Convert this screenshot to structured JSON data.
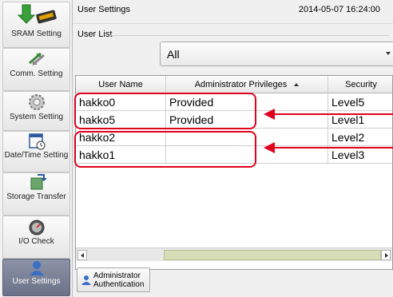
{
  "sidebar": {
    "items": [
      {
        "label": "SRAM Setting",
        "icon": "sram-icon",
        "active": false
      },
      {
        "label": "Comm. Setting",
        "icon": "comm-arrows-icon",
        "active": false
      },
      {
        "label": "System Setting",
        "icon": "gear-icon",
        "active": false
      },
      {
        "label": "Date/Time Setting",
        "icon": "calendar-clock-icon",
        "active": false
      },
      {
        "label": "Storage Transfer",
        "icon": "storage-transfer-icon",
        "active": false
      },
      {
        "label": "I/O Check",
        "icon": "gauge-icon",
        "active": false
      },
      {
        "label": "User Settings",
        "icon": "user-icon",
        "active": true
      }
    ]
  },
  "header": {
    "title": "User Settings",
    "timestamp": "2014-05-07 16:24:00"
  },
  "user_list": {
    "label": "User List",
    "filter": {
      "value": "All"
    },
    "columns": [
      "User Name",
      "Administrator Privileges",
      "Security"
    ],
    "rows": [
      {
        "name": "hakko0",
        "admin": "Provided",
        "security": "Level5"
      },
      {
        "name": "hakko5",
        "admin": "Provided",
        "security": "Level1"
      },
      {
        "name": "hakko2",
        "admin": "",
        "security": "Level2"
      },
      {
        "name": "hakko1",
        "admin": "",
        "security": "Level3"
      }
    ]
  },
  "admin_button": {
    "label": "Administrator Authentication",
    "icon": "user-key-icon"
  },
  "colors": {
    "annotation": "#e0001b",
    "active_sidebar": "#7a8096",
    "scroll_thumb": "#d6ddb7"
  }
}
